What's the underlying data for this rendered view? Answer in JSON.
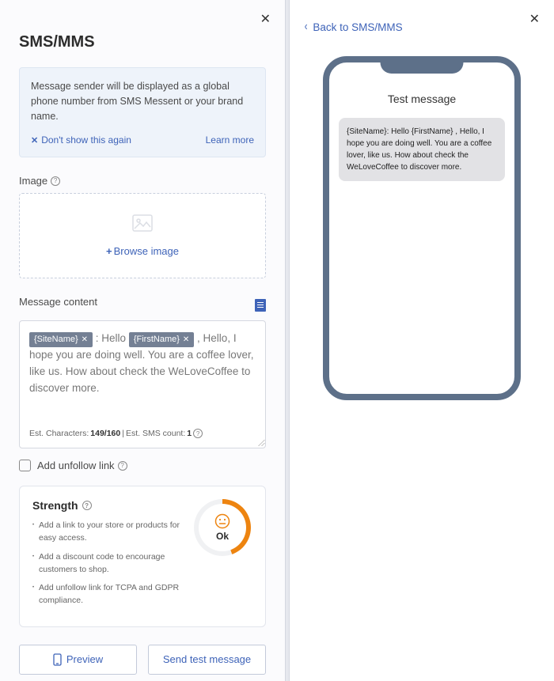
{
  "title": "SMS/MMS",
  "info": {
    "text": "Message sender will be displayed as a global phone number from SMS Messent or your brand name.",
    "dont_show": "Don't show this again",
    "learn": "Learn more"
  },
  "image": {
    "label": "Image",
    "browse": "Browse image"
  },
  "message": {
    "label": "Message content",
    "token1": "{SiteName}",
    "sep": " : Hello ",
    "token2": "{FirstName}",
    "rest": " , Hello, I hope you are doing well. You are a coffee lover, like us. How about check the WeLoveCoffee to discover more.",
    "stats": {
      "est_chars_label": "Est. Characters:",
      "est_chars_value": "149/160",
      "separator": "|",
      "est_sms_label": "Est. SMS count:",
      "est_sms_value": "1"
    }
  },
  "unfollow": {
    "label": "Add unfollow link"
  },
  "strength": {
    "title": "Strength",
    "tip1": "Add a link to your store or products for easy access.",
    "tip2": "Add a discount code to encourage customers to shop.",
    "tip3": "Add unfollow link for TCPA and GDPR compliance.",
    "rating": "Ok"
  },
  "footer": {
    "preview": "Preview",
    "send": "Send test message"
  },
  "preview": {
    "back": "Back to SMS/MMS",
    "title": "Test message",
    "bubble": "{SiteName}: Hello {FirstName} , Hello, I hope you are doing well. You are a coffee lover, like us. How about check the WeLoveCoffee to discover more."
  }
}
